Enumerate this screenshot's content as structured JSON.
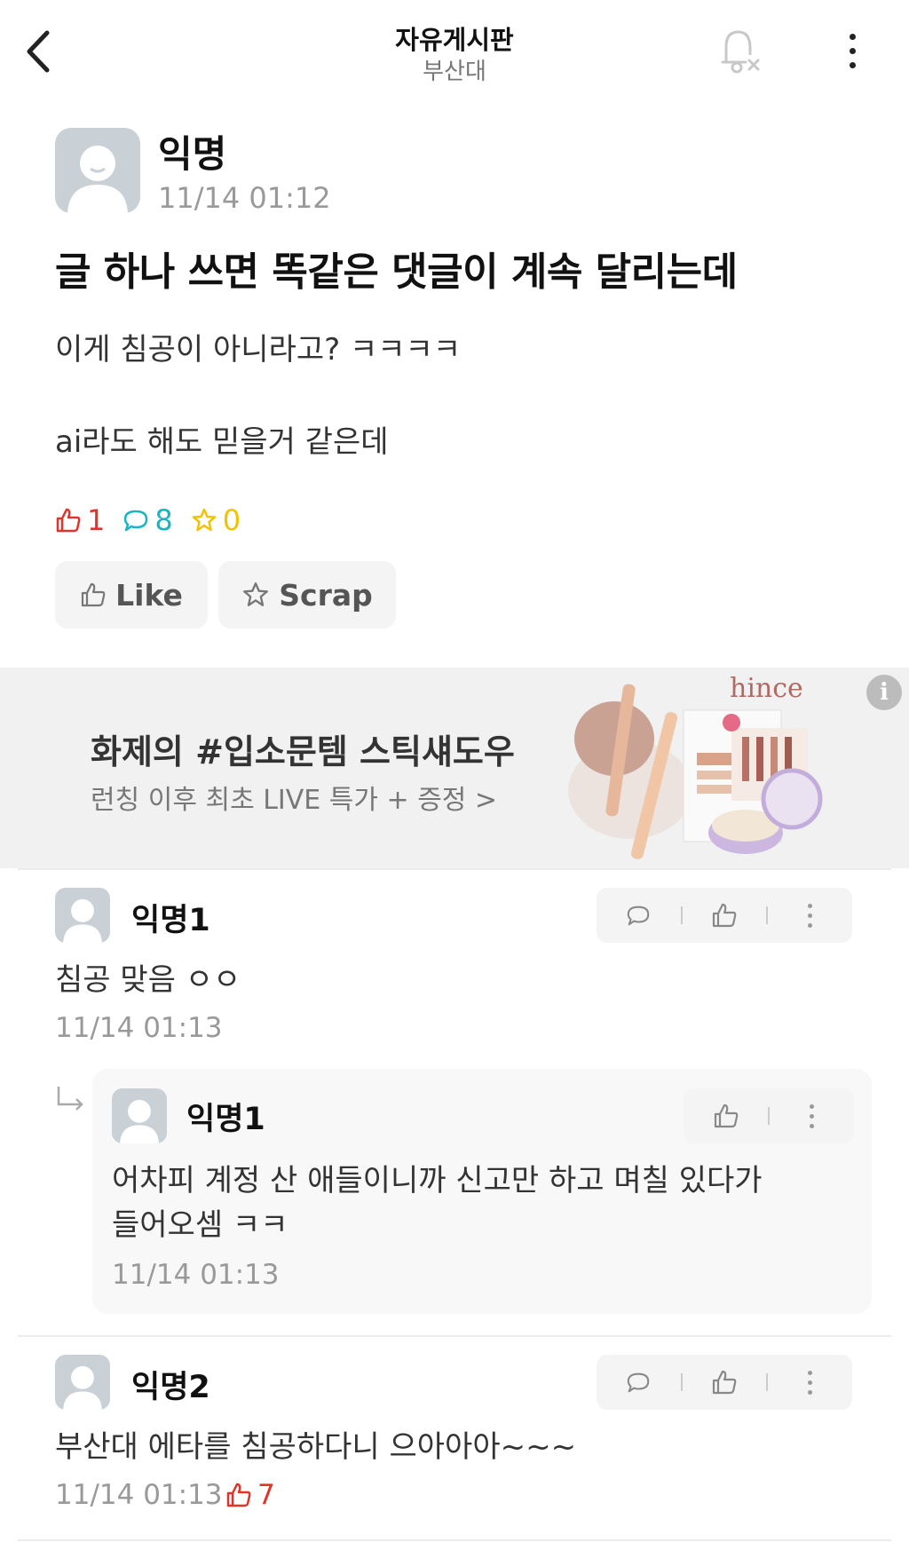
{
  "header": {
    "title": "자유게시판",
    "subtitle": "부산대"
  },
  "post": {
    "author": "익명",
    "time": "11/14 01:12",
    "title": "글 하나 쓰면 똑같은 댓글이 계속 달리는데",
    "body_line1": "이게 침공이 아니라고? ㅋㅋㅋㅋ",
    "body_line2": "ai라도 해도 믿을거 같은데",
    "stats": {
      "likes": "1",
      "comments": "8",
      "scraps": "0"
    },
    "like_label": "Like",
    "scrap_label": "Scrap"
  },
  "ad": {
    "title": "화제의 #입소문템 스틱섀도우",
    "subtitle": "런칭 이후 최초 LIVE 특가 + 증정 >",
    "brand": "hince",
    "info_icon": "i"
  },
  "comments": [
    {
      "author": "익명1",
      "body": "침공 맞음 ㅇㅇ",
      "time": "11/14 01:13"
    },
    {
      "author": "익명1",
      "body_line1": "어차피 계정 산 애들이니까 신고만 하고 며칠 있다가",
      "body_line2": "들어오셈 ㅋㅋ",
      "time": "11/14 01:13",
      "is_reply": true
    },
    {
      "author": "익명2",
      "body": "부산대 에타를 침공하다니 으아아아~~~",
      "time": "11/14 01:13",
      "likes": "7"
    }
  ],
  "colors": {
    "like": "#e0332b",
    "comment": "#19b5c4",
    "scrap": "#f2c200",
    "avatar": "#c9d0d6"
  }
}
